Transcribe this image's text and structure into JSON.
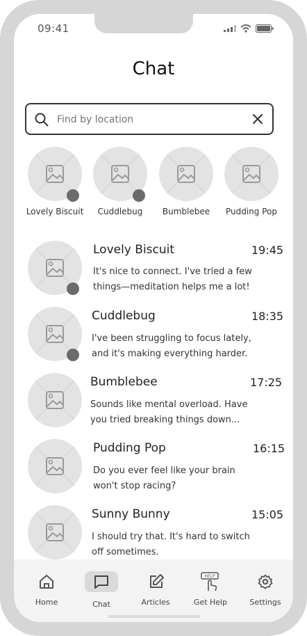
{
  "status": {
    "time": "09:41"
  },
  "header": {
    "title": "Chat"
  },
  "search": {
    "placeholder": "Find by location"
  },
  "stories": [
    {
      "name": "Lovely Biscuit",
      "online": true
    },
    {
      "name": "Cuddlebug",
      "online": true
    },
    {
      "name": "Bumblebee",
      "online": false
    },
    {
      "name": "Pudding Pop",
      "online": false
    }
  ],
  "chats": [
    {
      "name": "Lovely Biscuit",
      "time": "19:45",
      "line1": "It's nice to connect. I've tried a few",
      "line2": "things—meditation helps me a lot!",
      "online": true
    },
    {
      "name": "Cuddlebug",
      "time": "18:35",
      "line1": "I've been struggling to focus lately,",
      "line2": "and it's making everything harder.",
      "online": true
    },
    {
      "name": "Bumblebee",
      "time": "17:25",
      "line1": "Sounds like mental overload. Have",
      "line2": "you tried breaking things down...",
      "online": false
    },
    {
      "name": "Pudding Pop",
      "time": "16:15",
      "line1": "Do you ever feel like your brain",
      "line2": "won't stop racing?",
      "online": false
    },
    {
      "name": "Sunny Bunny",
      "time": "15:05",
      "line1": "I should try that. It's hard to switch",
      "line2": "off sometimes.",
      "online": false
    }
  ],
  "tabs": [
    {
      "label": "Home",
      "icon": "home-icon"
    },
    {
      "label": "Chat",
      "icon": "chat-icon",
      "active": true
    },
    {
      "label": "Articles",
      "icon": "edit-icon"
    },
    {
      "label": "Get Help",
      "icon": "help-icon",
      "badge": "HELP"
    },
    {
      "label": "Settings",
      "icon": "gear-icon"
    }
  ]
}
